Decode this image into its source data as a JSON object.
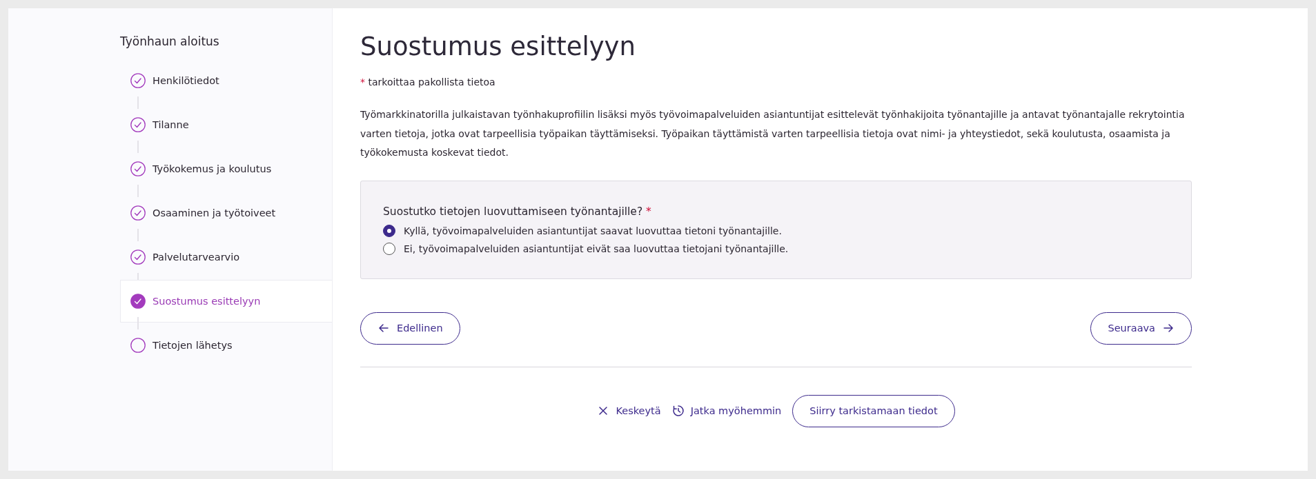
{
  "sidebar": {
    "title": "Työnhaun aloitus",
    "steps": [
      {
        "label": "Henkilötiedot",
        "completed": true,
        "selected": false
      },
      {
        "label": "Tilanne",
        "completed": true,
        "selected": false
      },
      {
        "label": "Työkokemus ja koulutus",
        "completed": true,
        "selected": false
      },
      {
        "label": "Osaaminen ja työtoiveet",
        "completed": true,
        "selected": false
      },
      {
        "label": "Palvelutarvearvio",
        "completed": true,
        "selected": false
      },
      {
        "label": "Suostumus esittelyyn",
        "completed": true,
        "selected": true
      },
      {
        "label": "Tietojen lähetys",
        "completed": false,
        "selected": false
      }
    ]
  },
  "main": {
    "title": "Suostumus esittelyyn",
    "required_mark": "*",
    "required_note": "tarkoittaa pakollista tietoa",
    "description": "Työmarkkinatorilla julkaistavan työnhakuprofiilin lisäksi myös työvoimapalveluiden asiantuntijat esittelevät työnhakijoita työnantajille ja antavat työnantajalle rekrytointia varten tietoja, jotka ovat tarpeellisia työpaikan täyttämiseksi. Työpaikan täyttämistä varten tarpeellisia tietoja ovat nimi- ja yhteystiedot, sekä koulutusta, osaamista ja työkokemusta koskevat tiedot.",
    "question": {
      "label": "Suostutko tietojen luovuttamiseen työnantajille?",
      "required_mark": "*",
      "options": [
        {
          "label": "Kyllä, työvoimapalveluiden asiantuntijat saavat luovuttaa tietoni työnantajille.",
          "selected": true
        },
        {
          "label": "Ei, työvoimapalveluiden asiantuntijat eivät saa luovuttaa tietojani työnantajille.",
          "selected": false
        }
      ]
    },
    "previous_button": "Edellinen",
    "next_button": "Seuraava",
    "footer": {
      "cancel": "Keskeytä",
      "later": "Jatka myöhemmin",
      "review": "Siirry tarkistamaan tiedot"
    }
  }
}
